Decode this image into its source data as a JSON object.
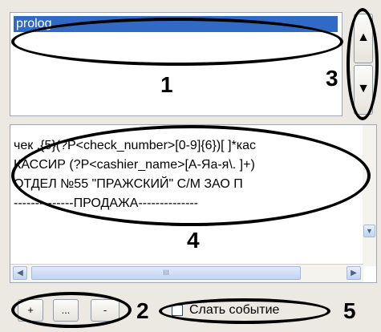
{
  "list": {
    "items": [
      "prolog"
    ]
  },
  "updown": {
    "up_glyph": "▲",
    "down_glyph": "▼"
  },
  "script_text": {
    "lines": [
      "чек .{5}(?P<check_number>[0-9]{6})[ ]*кас",
      "КАССИР (?P<cashier_name>[А-Яа-я\\. ]+)",
      "ОТДЕЛ  №55 \"ПРАЖСКИЙ\" С/М ЗАО П",
      "--------------ПРОДАЖА--------------"
    ]
  },
  "scrollbar": {
    "left_glyph": "◀",
    "right_glyph": "▶",
    "thumb_grip": "III",
    "down_glyph": "▼"
  },
  "buttons": {
    "add_label": "+",
    "more_label": "...",
    "remove_label": "-"
  },
  "send_event": {
    "label": "Слать событие",
    "checked": false
  },
  "callouts": {
    "n1": "1",
    "n2": "2",
    "n3": "3",
    "n4": "4",
    "n5": "5"
  }
}
